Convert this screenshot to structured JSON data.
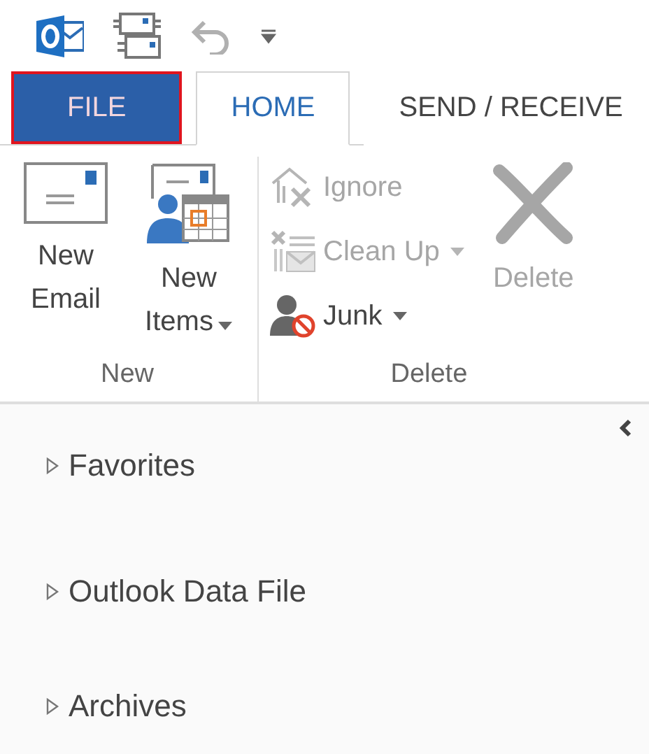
{
  "tabs": [
    {
      "label": "FILE",
      "kind": "backstage",
      "selected": false,
      "outlined": true
    },
    {
      "label": "HOME",
      "kind": "tab",
      "selected": true,
      "outlined": false
    },
    {
      "label": "SEND / RECEIVE",
      "kind": "tab",
      "selected": false,
      "outlined": false
    }
  ],
  "ribbon": {
    "groups": [
      {
        "label": "New",
        "buttons": [
          {
            "label": "New Email",
            "kind": "large",
            "dropdown": false,
            "disabled": false
          },
          {
            "label": "New Items",
            "kind": "large",
            "dropdown": true,
            "disabled": false
          }
        ]
      },
      {
        "label": "Delete",
        "buttons": [
          {
            "label": "Ignore",
            "kind": "small",
            "dropdown": false,
            "disabled": true
          },
          {
            "label": "Clean Up",
            "kind": "small",
            "dropdown": true,
            "disabled": true
          },
          {
            "label": "Junk",
            "kind": "small",
            "dropdown": true,
            "disabled": false
          },
          {
            "label": "Delete",
            "kind": "large",
            "dropdown": false,
            "disabled": true
          }
        ]
      }
    ]
  },
  "folder_pane": {
    "folders": [
      {
        "label": "Favorites",
        "expanded": false
      },
      {
        "label": "Outlook Data File",
        "expanded": false
      },
      {
        "label": "Archives",
        "expanded": false
      }
    ]
  }
}
